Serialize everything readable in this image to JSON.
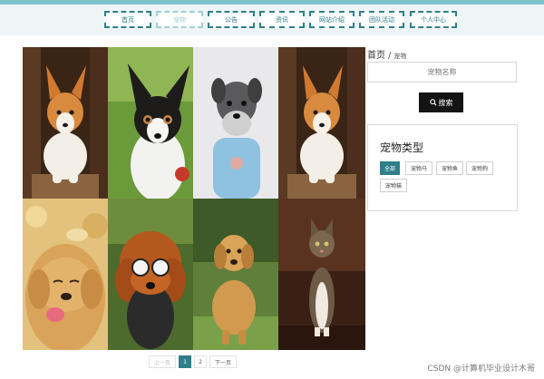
{
  "nav": {
    "items": [
      {
        "label": "首页",
        "active": false
      },
      {
        "label": "宠物",
        "active": true
      },
      {
        "label": "公告",
        "active": false
      },
      {
        "label": "资讯",
        "active": false
      },
      {
        "label": "网站介绍",
        "active": false
      },
      {
        "label": "团队活动",
        "active": false
      },
      {
        "label": "个人中心",
        "active": false
      }
    ]
  },
  "gallery": {
    "items": [
      {
        "icon": "corgi-photo"
      },
      {
        "icon": "chihuahua-photo"
      },
      {
        "icon": "schnauzer-photo"
      },
      {
        "icon": "corgi-photo"
      },
      {
        "icon": "golden-retriever-photo"
      },
      {
        "icon": "poodle-photo"
      },
      {
        "icon": "golden-retriever-photo"
      },
      {
        "icon": "cat-photo"
      }
    ]
  },
  "pagination": {
    "prev": "上一页",
    "current": "1",
    "next_page": "2",
    "next": "下一页"
  },
  "breadcrumb": {
    "home": "首页",
    "separator": "/",
    "current": "宠物"
  },
  "search": {
    "placeholder": "宠物名称",
    "button_label": "搜索"
  },
  "category": {
    "title": "宠物类型",
    "tags": [
      {
        "label": "全部",
        "active": true
      },
      {
        "label": "宠物马",
        "active": false
      },
      {
        "label": "宠物鱼",
        "active": false
      },
      {
        "label": "宠物狗",
        "active": false
      },
      {
        "label": "宠物猫",
        "active": false
      }
    ]
  },
  "watermark": "CSDN @计算机毕业设计木哥",
  "colors": {
    "accent": "#2f7f8a",
    "nav_bg": "#eef5f6",
    "button_dark": "#141414"
  }
}
